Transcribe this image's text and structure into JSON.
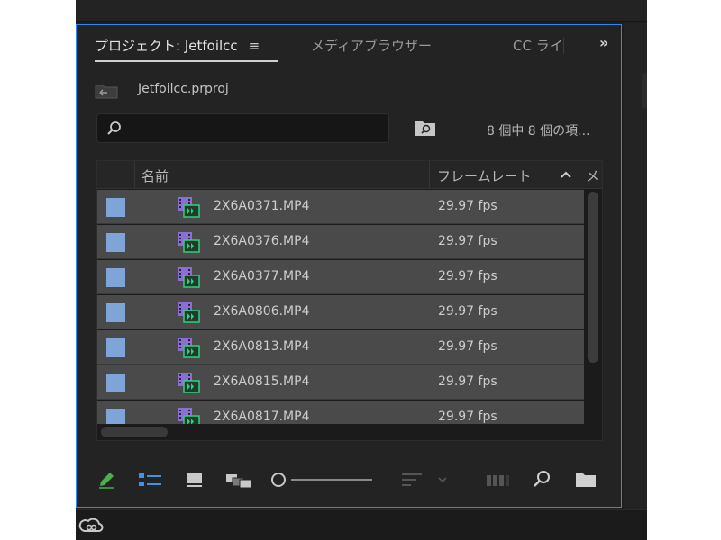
{
  "tabs": {
    "project": "プロジェクト: Jetfoilcc",
    "project_menu": "≡",
    "media_browser": "メディアブラウザー",
    "cc_libraries": "CC ライ",
    "overflow": "»"
  },
  "project": {
    "file_name": "Jetfoilcc.prproj",
    "search_placeholder": "",
    "item_count": "8 個中 8 個の項..."
  },
  "list": {
    "columns": [
      "名前",
      "フレームレート",
      "メ"
    ],
    "sort_indicator": "^",
    "label_color": "#7fa4d8",
    "rows": [
      {
        "name": "2X6A0371.MP4",
        "frame_rate": "29.97 fps"
      },
      {
        "name": "2X6A0376.MP4",
        "frame_rate": "29.97 fps"
      },
      {
        "name": "2X6A0377.MP4",
        "frame_rate": "29.97 fps"
      },
      {
        "name": "2X6A0806.MP4",
        "frame_rate": "29.97 fps"
      },
      {
        "name": "2X6A0813.MP4",
        "frame_rate": "29.97 fps"
      },
      {
        "name": "2X6A0815.MP4",
        "frame_rate": "29.97 fps"
      },
      {
        "name": "2X6A0817.MP4",
        "frame_rate": "29.97 fps"
      }
    ]
  },
  "colors": {
    "panel_focus": "#2d8ceb",
    "pencil_active": "#46b04a",
    "list_view_active": "#3f93ea"
  },
  "toolbar": {
    "icons": [
      "pencil-icon",
      "list-view-icon",
      "icon-view-icon",
      "freeform-view-icon",
      "zoom-slider",
      "sort-icons-icon",
      "automate-to-sequence-icon",
      "find-icon",
      "new-bin-icon"
    ]
  }
}
